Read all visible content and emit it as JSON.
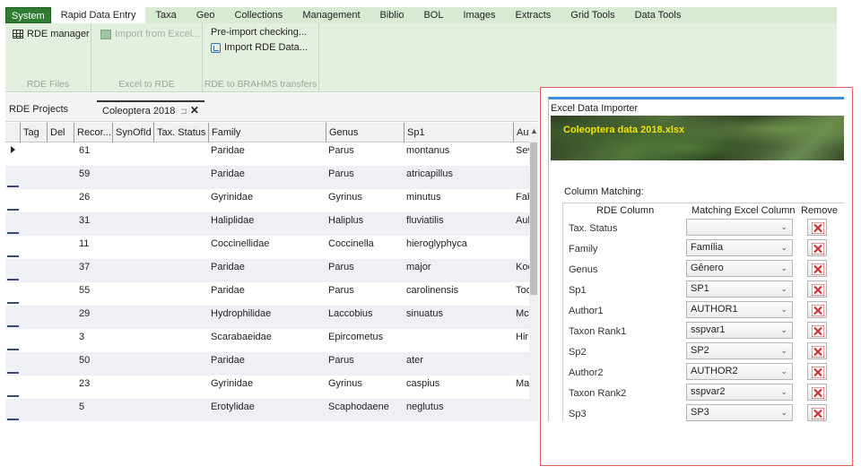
{
  "menu": {
    "tabs": [
      {
        "label": "System"
      },
      {
        "label": "Rapid Data Entry"
      },
      {
        "label": "Taxa"
      },
      {
        "label": "Geo"
      },
      {
        "label": "Collections"
      },
      {
        "label": "Management"
      },
      {
        "label": "Biblio"
      },
      {
        "label": "BOL"
      },
      {
        "label": "Images"
      },
      {
        "label": "Extracts"
      },
      {
        "label": "Grid Tools"
      },
      {
        "label": "Data Tools"
      }
    ],
    "active": "Rapid Data Entry"
  },
  "ribbon": {
    "rde_manager": "RDE manager",
    "import_from_excel": "Import from Excel...",
    "pre_import_checking": "Pre-import checking...",
    "import_rde_data": "Import RDE Data...",
    "group_rde_files": "RDE Files",
    "group_excel_to_rde": "Excel to RDE",
    "group_rde_to_brahms": "RDE to BRAHMS transfers"
  },
  "doc_tabs": {
    "projects": "RDE Projects",
    "current": "Coleoptera 2018",
    "pin_icon": "pin-icon",
    "close_icon": "close-icon"
  },
  "grid": {
    "columns": [
      "Tag",
      "Del",
      "Recor...",
      "SynOfId",
      "Tax. Status",
      "Family",
      "Genus",
      "Sp1",
      "Aut"
    ],
    "rows": [
      {
        "record": "61",
        "family": "Paridae",
        "genus": "Parus",
        "sp1": "montanus",
        "author": "Sev"
      },
      {
        "record": "59",
        "family": "Paridae",
        "genus": "Parus",
        "sp1": "atricapillus",
        "author": ""
      },
      {
        "record": "26",
        "family": "Gyrinidae",
        "genus": "Gyrinus",
        "sp1": "minutus",
        "author": "Fab"
      },
      {
        "record": "31",
        "family": "Haliplidae",
        "genus": "Haliplus",
        "sp1": "fluviatilis",
        "author": "Aul"
      },
      {
        "record": "11",
        "family": "Coccinellidae",
        "genus": "Coccinella",
        "sp1": "hieroglyphyca",
        "author": ""
      },
      {
        "record": "37",
        "family": "Paridae",
        "genus": "Parus",
        "sp1": "major",
        "author": "Koe"
      },
      {
        "record": "55",
        "family": "Paridae",
        "genus": "Parus",
        "sp1": "carolinensis",
        "author": "Toc"
      },
      {
        "record": "29",
        "family": "Hydrophilidae",
        "genus": "Laccobius",
        "sp1": "sinuatus",
        "author": "Mc"
      },
      {
        "record": "3",
        "family": "Scarabaeidae",
        "genus": "Epircometus",
        "sp1": "",
        "author": "Hir"
      },
      {
        "record": "50",
        "family": "Paridae",
        "genus": "Parus",
        "sp1": "ater",
        "author": ""
      },
      {
        "record": "23",
        "family": "Gyrinidae",
        "genus": "Gyrinus",
        "sp1": "caspius",
        "author": "Ma"
      },
      {
        "record": "5",
        "family": "Erotylidae",
        "genus": "Scaphodaene",
        "sp1": "neglutus",
        "author": ""
      }
    ]
  },
  "importer": {
    "title": "Excel Data Importer",
    "banner_text": "Coleoptera data 2018.xlsx",
    "column_matching_label": "Column Matching:",
    "headers": {
      "rde": "RDE Column",
      "excel": "Matching Excel Column",
      "remove": "Remove"
    },
    "rows": [
      {
        "rde": "Tax. Status",
        "excel": ""
      },
      {
        "rde": "Family",
        "excel": "Família"
      },
      {
        "rde": "Genus",
        "excel": "Gênero"
      },
      {
        "rde": "Sp1",
        "excel": "SP1"
      },
      {
        "rde": "Author1",
        "excel": "AUTHOR1"
      },
      {
        "rde": "Taxon Rank1",
        "excel": "sspvar1"
      },
      {
        "rde": "Sp2",
        "excel": "SP2"
      },
      {
        "rde": "Author2",
        "excel": "AUTHOR2"
      },
      {
        "rde": "Taxon Rank2",
        "excel": "sspvar2"
      },
      {
        "rde": "Sp3",
        "excel": "SP3"
      }
    ]
  },
  "colors": {
    "accent": "#3b8ede",
    "ribbon": "#e4f0df",
    "system_tab": "#2e7d32",
    "remove_x": "#d32f2f",
    "highlight_border": "#e06060"
  }
}
